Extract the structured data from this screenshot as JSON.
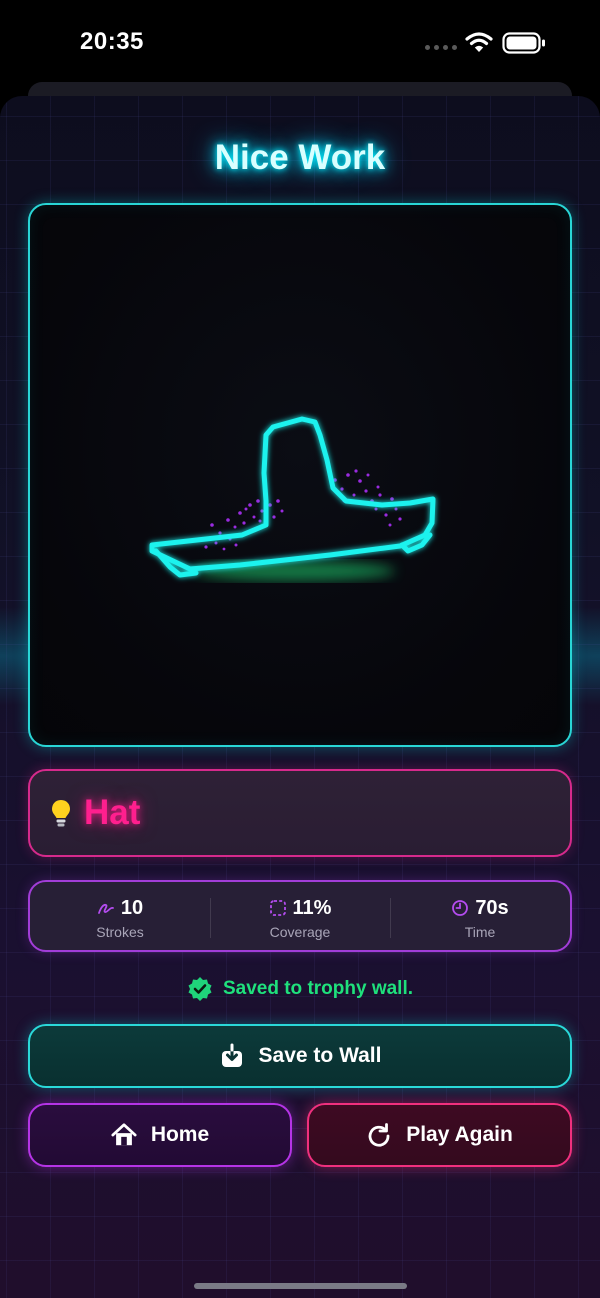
{
  "status_bar": {
    "time": "20:35"
  },
  "header": {
    "title": "Nice Work"
  },
  "guess": {
    "icon": "lightbulb-icon",
    "text": "Hat"
  },
  "stats": [
    {
      "icon": "pen-stroke-icon",
      "value": "10",
      "label": "Strokes"
    },
    {
      "icon": "dashed-square-icon",
      "value": "11%",
      "label": "Coverage"
    },
    {
      "icon": "clock-icon",
      "value": "70s",
      "label": "Time"
    }
  ],
  "saved_notice": {
    "icon": "check-badge-icon",
    "text": "Saved to trophy wall."
  },
  "buttons": {
    "save_label": "Save to Wall",
    "home_label": "Home",
    "play_again_label": "Play Again"
  },
  "colors": {
    "accent_cyan": "#2ad9d9",
    "accent_pink": "#ff1f8e",
    "accent_purple": "#b534e6",
    "success_green": "#1fe07c"
  }
}
